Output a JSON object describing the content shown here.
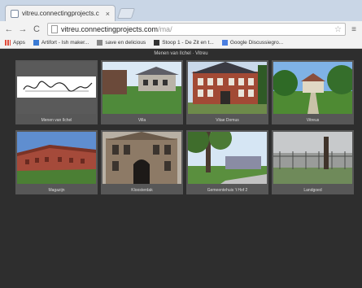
{
  "browser": {
    "tab_title": "vitreu.connectingprojects.c",
    "tab_close": "×",
    "url_host": "vitreu.connectingprojects.com",
    "url_path": "/ma/",
    "back_glyph": "←",
    "forward_glyph": "→",
    "reload_glyph": "C",
    "star_glyph": "☆",
    "menu_glyph": "≡"
  },
  "bookmarks": [
    {
      "label": "Apps",
      "icon": "apps-grid-icon",
      "color": "#e04b3a"
    },
    {
      "label": "Artifort - Ish maker...",
      "icon": "bookmark-favicon",
      "color": "#3a7bd5"
    },
    {
      "label": "save en delicious",
      "icon": "page-icon",
      "color": "#888888"
    },
    {
      "label": "Stoop 1 - De Zit en t...",
      "icon": "bookmark-favicon",
      "color": "#333333"
    },
    {
      "label": "Google Discussiegro...",
      "icon": "google-groups-icon",
      "color": "#4a7ee0"
    }
  ],
  "page": {
    "heading": "Menen van Ilchel · Vitreu",
    "tiles": [
      {
        "caption": "Menen van Ilchel",
        "scene": "logo"
      },
      {
        "caption": "Villa",
        "scene": "villa"
      },
      {
        "caption": "Vitae Domus",
        "scene": "manor"
      },
      {
        "caption": "Vitreus",
        "scene": "lane"
      },
      {
        "caption": "Magazijn",
        "scene": "warehouse"
      },
      {
        "caption": "Kloosterdak",
        "scene": "gate"
      },
      {
        "caption": "Gemeentehuis 't Hof 2",
        "scene": "park"
      },
      {
        "caption": "Landgoed",
        "scene": "fence"
      }
    ]
  }
}
